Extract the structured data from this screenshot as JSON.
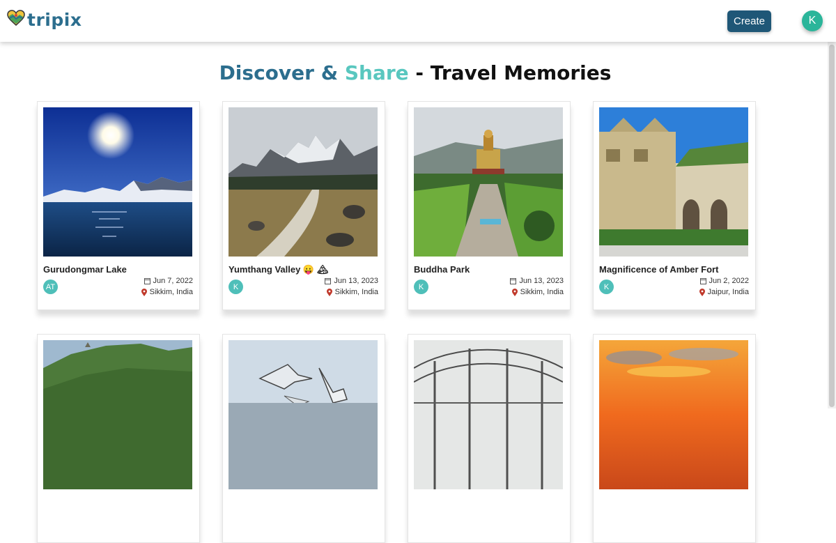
{
  "app": {
    "name": "tripix",
    "brand_color": "#2c6e8e",
    "accent_color": "#59c7bf"
  },
  "header": {
    "create_label": "Create",
    "user_initial": "K"
  },
  "heading": {
    "part1": "Discover",
    "amp": "&",
    "part2": "Share",
    "part3": " - Travel Memories"
  },
  "posts": [
    {
      "title": "Gurudongmar Lake",
      "date": "Jun 7, 2022",
      "location": "Sikkim, India",
      "author_initials": "AT",
      "image": "lake-mountains-photo"
    },
    {
      "title": "Yumthang Valley 😛 🏔",
      "date": "Jun 13, 2023",
      "location": "Sikkim, India",
      "author_initials": "K",
      "image": "valley-mountains-photo"
    },
    {
      "title": "Buddha Park",
      "date": "Jun 13, 2023",
      "location": "Sikkim, India",
      "author_initials": "K",
      "image": "buddha-statue-park-photo"
    },
    {
      "title": "Magnificence of Amber Fort",
      "date": "Jun 2, 2022",
      "location": "Jaipur, India",
      "author_initials": "K",
      "image": "amber-fort-photo"
    },
    {
      "image": "green-hill-fort-photo"
    },
    {
      "image": "seagulls-photo"
    },
    {
      "image": "glasshouse-photo"
    },
    {
      "image": "sunset-clouds-photo"
    }
  ],
  "icons": {
    "logo": "heart-map-icon",
    "date": "calendar-icon",
    "location": "map-pin-icon"
  }
}
